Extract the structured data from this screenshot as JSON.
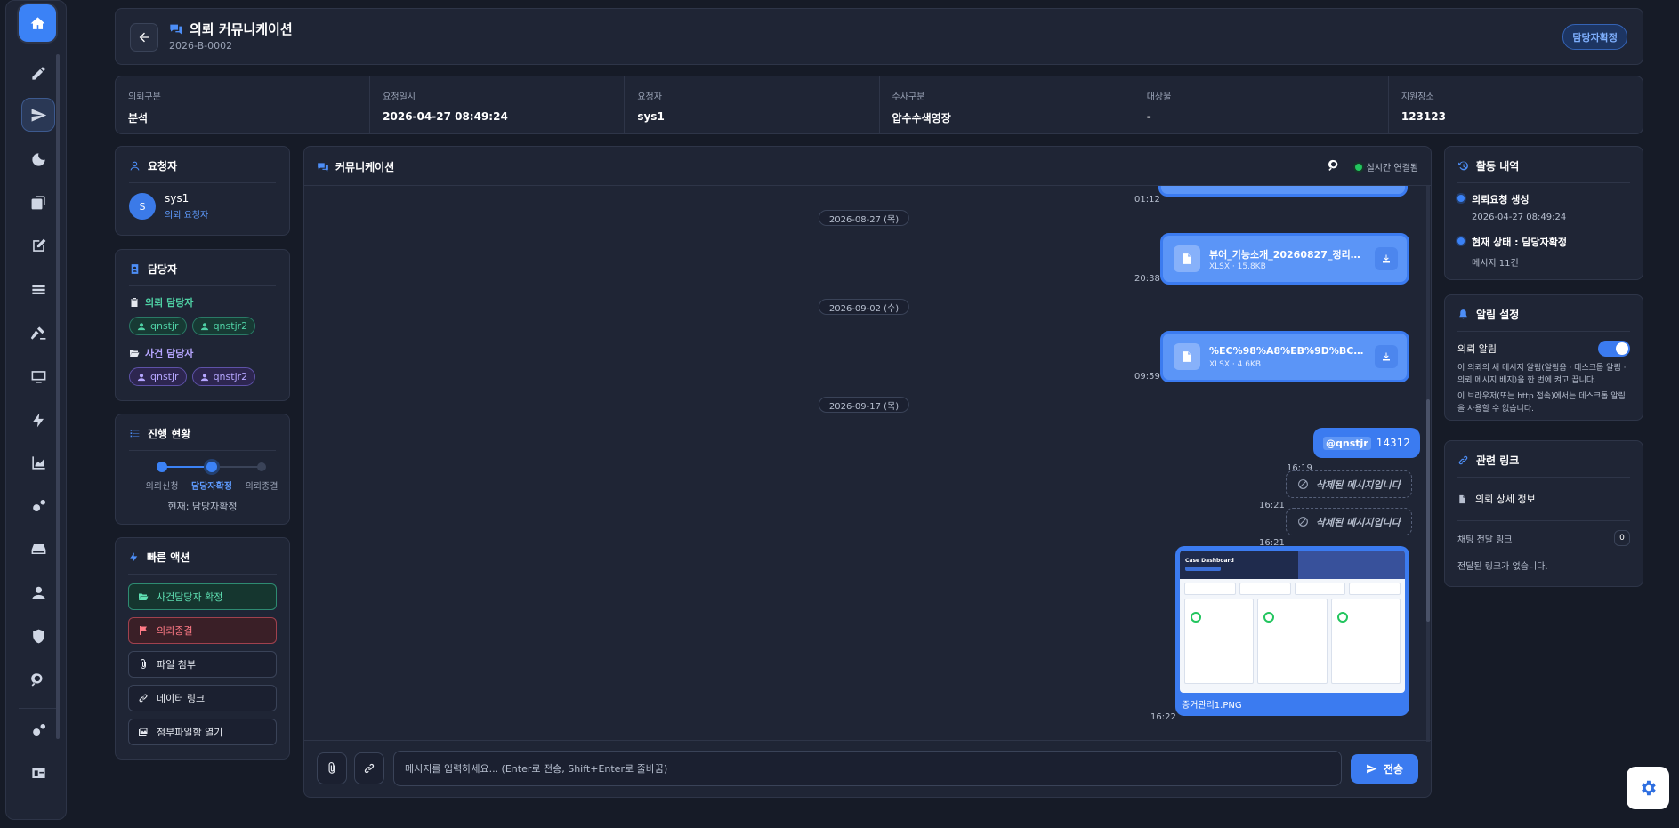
{
  "header": {
    "title": "의뢰 커뮤니케이션",
    "case_no": "2026-B-0002",
    "status": "담당자확정"
  },
  "info": [
    {
      "label": "의뢰구분",
      "value": "분석"
    },
    {
      "label": "요청일시",
      "value": "2026-04-27 08:49:24"
    },
    {
      "label": "요청자",
      "value": "sys1"
    },
    {
      "label": "수사구분",
      "value": "압수수색영장"
    },
    {
      "label": "대상물",
      "value": "-"
    },
    {
      "label": "지원장소",
      "value": "123123"
    }
  ],
  "requester": {
    "title": "요청자",
    "avatar": "S",
    "name": "sys1",
    "role": "의뢰 요청자"
  },
  "managers": {
    "title": "담당자",
    "request_label": "의뢰 담당자",
    "request_chips": [
      "qnstjr",
      "qnstjr2"
    ],
    "case_label": "사건 담당자",
    "case_chips": [
      "qnstjr",
      "qnstjr2"
    ]
  },
  "progress": {
    "title": "진행 현황",
    "steps": [
      "의뢰신청",
      "담당자확정",
      "의뢰종결"
    ],
    "current": "현재: 담당자확정"
  },
  "quick": {
    "title": "빠른 액션",
    "buttons": [
      "사건담당자 확정",
      "의뢰종결",
      "파일 첨부",
      "데이터 링크",
      "첨부파일함 열기"
    ]
  },
  "chat": {
    "title": "커뮤니케이션",
    "live": "실시간 연결됨",
    "top_time": "01:12",
    "dates": [
      "2026-08-27 (목)",
      "2026-09-02 (수)",
      "2026-09-17 (목)"
    ],
    "files": [
      {
        "name": "뷰어_기능소개_20260827_정리본...",
        "meta": "XLSX · 15.8KB",
        "time": "20:38"
      },
      {
        "name": "%EC%98%A8%EB%9D%BC%EC...",
        "meta": "XLSX · 4.6KB",
        "time": "09:59"
      }
    ],
    "text_msg": {
      "mention": "@qnstjr",
      "text": "14312",
      "time": "16:19"
    },
    "deleted": [
      {
        "text": "삭제된 메시지입니다",
        "time": "16:21"
      },
      {
        "text": "삭제된 메시지입니다",
        "time": "16:21"
      }
    ],
    "image": {
      "caption": "증거관리1.PNG",
      "time": "16:22",
      "thumb_title": "Case Dashboard"
    },
    "input_placeholder": "메시지를 입력하세요... (Enter로 전송, Shift+Enter로 줄바꿈)",
    "send": "전송"
  },
  "activity": {
    "title": "활동 내역",
    "items": [
      {
        "title": "의뢰요청 생성",
        "sub": "2026-04-27 08:49:24"
      },
      {
        "title": "현재 상태 : 담당자확정",
        "sub": "메시지 11건"
      }
    ]
  },
  "alert": {
    "title": "알림 설정",
    "toggle_label": "의뢰 알림",
    "toggle_on": true,
    "desc1": "이 의뢰의 새 메시지 알림(알림음 · 데스크톱 알림 · 의뢰 메시지 배지)을 한 번에 켜고 끕니다.",
    "desc2": "이 브라우저(또는 http 접속)에서는 데스크톱 알림을 사용할 수 없습니다."
  },
  "links": {
    "title": "관련 링크",
    "detail": "의뢰 상세 정보",
    "chat_label": "채팅 전달 링크",
    "chat_count": "0",
    "empty": "전달된 링크가 없습니다."
  },
  "colors": {
    "accent": "#3b82f6",
    "bg": "#161b27",
    "panel": "#1f2535"
  }
}
